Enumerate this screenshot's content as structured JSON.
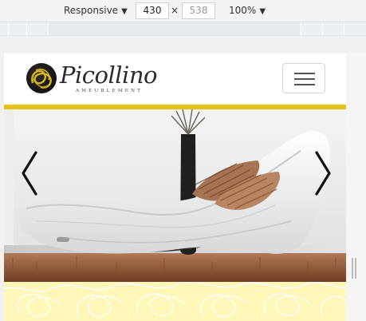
{
  "devtools": {
    "device": "Responsive",
    "width": "430",
    "height": "538",
    "times": "×",
    "zoom": "100%",
    "caret": "▼"
  },
  "site": {
    "brand": "Picollino",
    "tagline": "AMEUBLEMENT"
  },
  "colors": {
    "accent_line": "#e5c21a",
    "pattern_bg": "#fff7b8"
  },
  "icons": {
    "menu": "hamburger-icon",
    "prev": "chevron-left-icon",
    "next": "chevron-right-icon"
  }
}
